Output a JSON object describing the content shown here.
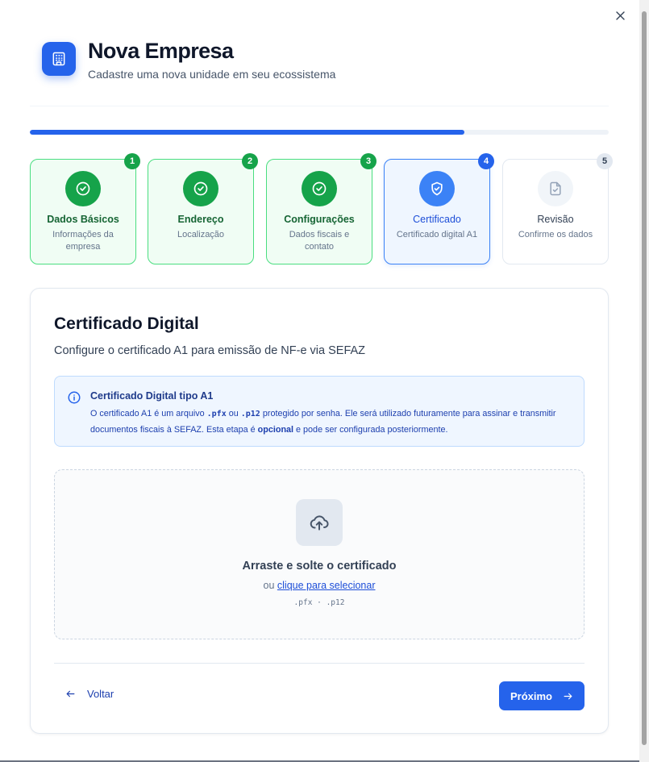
{
  "header": {
    "title": "Nova Empresa",
    "subtitle": "Cadastre uma nova unidade em seu ecossistema",
    "logo_icon": "building-icon",
    "close_icon": "close-icon"
  },
  "progress": {
    "value": 0.75
  },
  "steps": [
    {
      "number": "1",
      "label": "Dados Básicos",
      "desc": "Informações da empresa",
      "state": "done"
    },
    {
      "number": "2",
      "label": "Endereço",
      "desc": "Localização",
      "state": "done"
    },
    {
      "number": "3",
      "label": "Configurações",
      "desc": "Dados fiscais e contato",
      "state": "done"
    },
    {
      "number": "4",
      "label": "Certificado",
      "desc": "Certificado digital A1",
      "state": "active"
    },
    {
      "number": "5",
      "label": "Revisão",
      "desc": "Confirme os dados",
      "state": "todo"
    }
  ],
  "card": {
    "title": "Certificado Digital",
    "subtitle": "Configure o certificado A1 para emissão de NF-e via SEFAZ",
    "info": {
      "title": "Certificado Digital tipo A1",
      "text_1": "O certificado A1 é um arquivo ",
      "ext_pfx": ".pfx",
      "text_2": " ou ",
      "ext_p12": ".p12",
      "text_3": " protegido por senha. Ele será utilizado futuramente para assinar e transmitir documentos fiscais à SEFAZ. Esta etapa é ",
      "emphasis": "opcional",
      "text_4": " e pode ser configurada posteriormente."
    },
    "dropzone": {
      "title": "Arraste e solte o certificado",
      "or_text": "ou ",
      "link": "clique para selecionar",
      "extensions": ".pfx · .p12"
    }
  },
  "footer": {
    "back_label": "Voltar",
    "next_label": "Próximo"
  },
  "colors": {
    "primary": "#2563eb",
    "success": "#16a34a",
    "done_bg": "#f0fdf4"
  }
}
